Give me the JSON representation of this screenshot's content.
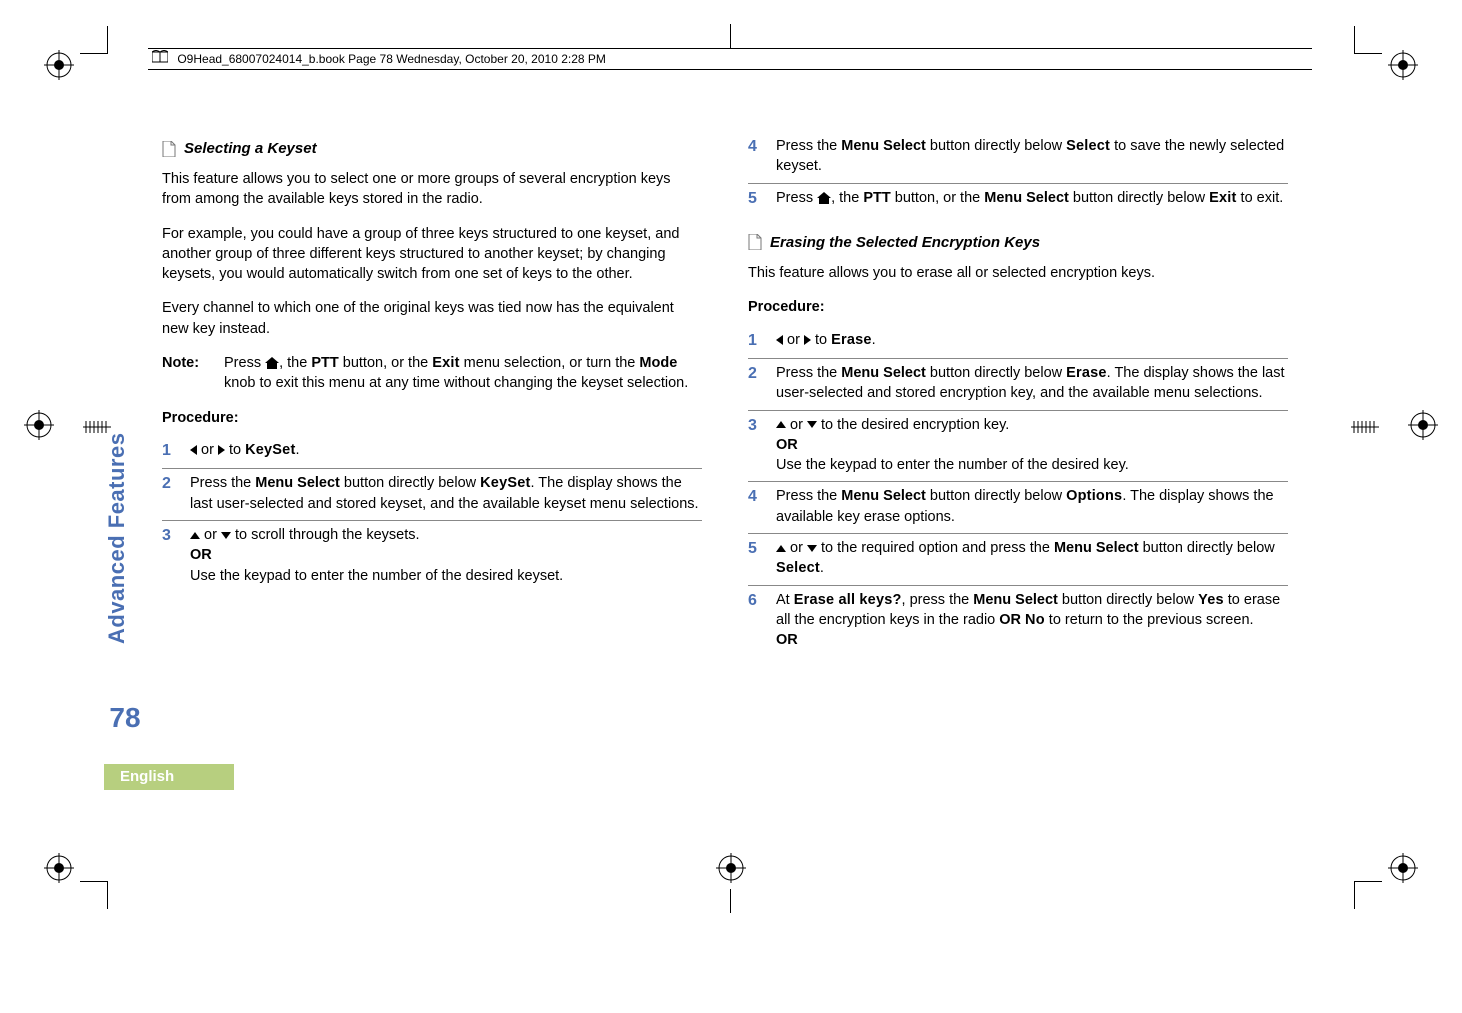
{
  "header": {
    "text": "O9Head_68007024014_b.book  Page 78  Wednesday, October 20, 2010  2:28 PM"
  },
  "side": {
    "tab": "Advanced Features",
    "page": "78",
    "language": "English"
  },
  "left": {
    "section_title": "Selecting a Keyset",
    "p1": "This feature allows you to select one or more groups of several encryption keys from among the available keys stored in the radio.",
    "p2": "For example, you could have a group of three keys structured to one keyset, and another group of three different keys structured to another keyset; by changing keysets, you would automatically switch from one set of keys to the other.",
    "p3": "Every channel to which one of the original keys was tied now has the equivalent new key instead.",
    "note_label": "Note:",
    "note_pre": "Press ",
    "note_mid1": ", the ",
    "note_ptt": "PTT",
    "note_mid2": " button, or the ",
    "note_exit": "Exit",
    "note_mid3": " menu selection, or turn the ",
    "note_mode": "Mode",
    "note_end": " knob to exit this menu at any time without changing the keyset selection.",
    "procedure": "Procedure:",
    "s1_or": " or ",
    "s1_to": " to ",
    "s1_keyset": "KeySet",
    "s1_dot": ".",
    "s2_a": "Press the ",
    "s2_ms": "Menu Select",
    "s2_b": " button directly below ",
    "s2_keyset": "KeySet",
    "s2_c": ". The display shows the last user-selected and stored keyset, and the available keyset menu selections.",
    "s3_or": " or ",
    "s3_a": " to scroll through the keysets.",
    "s3_OR": "OR",
    "s3_b": "Use the keypad to enter the number of the desired keyset."
  },
  "right": {
    "s4_a": "Press the ",
    "s4_ms": "Menu Select",
    "s4_b": " button directly below ",
    "s4_sel": "Select",
    "s4_c": " to save the newly selected keyset.",
    "s5_a": "Press ",
    "s5_b": ", the ",
    "s5_ptt": "PTT",
    "s5_c": " button, or the ",
    "s5_ms": "Menu Select",
    "s5_d": " button directly below ",
    "s5_exit": "Exit",
    "s5_e": " to exit.",
    "section_title": "Erasing the Selected Encryption Keys",
    "p1": "This feature allows you to erase all or selected encryption keys.",
    "procedure": "Procedure:",
    "r1_or": " or ",
    "r1_to": " to ",
    "r1_erase": "Erase",
    "r1_dot": ".",
    "r2_a": "Press the ",
    "r2_ms": "Menu Select",
    "r2_b": " button directly below ",
    "r2_erase": "Erase",
    "r2_c": ". The display shows the last user-selected and stored encryption key, and the available menu selections.",
    "r3_or": " or ",
    "r3_a": " to the desired encryption key.",
    "r3_OR": "OR",
    "r3_b": "Use the keypad to enter the number of the desired key.",
    "r4_a": "Press the ",
    "r4_ms": "Menu Select",
    "r4_b": " button directly below ",
    "r4_opt": "Options",
    "r4_c": ". The display shows the available key erase options.",
    "r5_or": " or ",
    "r5_a": " to the required option and press the ",
    "r5_ms": "Menu Select",
    "r5_b": " button directly below ",
    "r5_sel": "Select",
    "r5_c": ".",
    "r6_a": "At ",
    "r6_eak": "Erase all keys?",
    "r6_b": ", press the ",
    "r6_ms": "Menu Select",
    "r6_c": " button directly below ",
    "r6_yes": "Yes",
    "r6_d": " to erase all the encryption keys in the radio ",
    "r6_OR1": "OR",
    "r6_sp": " ",
    "r6_no": "No",
    "r6_e": " to return to the previous screen.",
    "r6_OR2": "OR"
  },
  "step_nums": {
    "n1": "1",
    "n2": "2",
    "n3": "3",
    "n4": "4",
    "n5": "5",
    "n6": "6"
  }
}
